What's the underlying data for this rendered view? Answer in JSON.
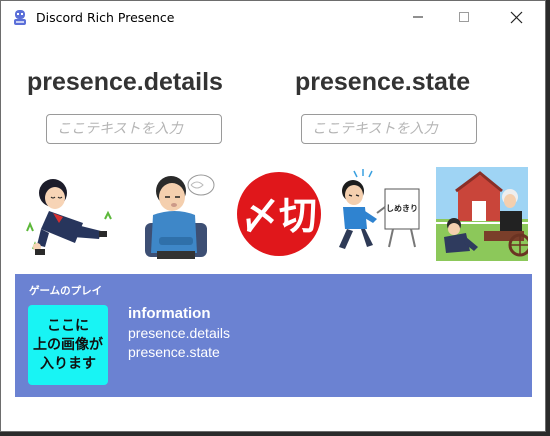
{
  "window": {
    "title": "Discord Rich Presence",
    "icons": {
      "app": "discord-app-icon",
      "minimize": "minimize-icon",
      "maximize": "maximize-icon",
      "close": "close-icon"
    }
  },
  "details": {
    "heading": "presence.details",
    "placeholder": "ここテキストを入力",
    "value": ""
  },
  "state": {
    "heading": "presence.state",
    "placeholder": "ここテキストを入力",
    "value": ""
  },
  "pictures": [
    {
      "name": "lying-student-illustration"
    },
    {
      "name": "sleeping-man-illustration"
    },
    {
      "name": "shimekiri-mark"
    },
    {
      "name": "deadline-chase-illustration"
    },
    {
      "name": "farm-scene-illustration"
    }
  ],
  "picture_texts": {
    "shimekiri_mark": "〆切",
    "deadline_paper": "しめきり"
  },
  "activity": {
    "label": "ゲームのプレイ",
    "image_text": "ここに\n上の画像が\n入ります",
    "info_title": "information",
    "line1": "presence.details",
    "line2": "presence.state"
  },
  "colors": {
    "panel": "#6b82d2",
    "image_slot": "#18f4f4",
    "shimekiri_red": "#e0171b"
  }
}
